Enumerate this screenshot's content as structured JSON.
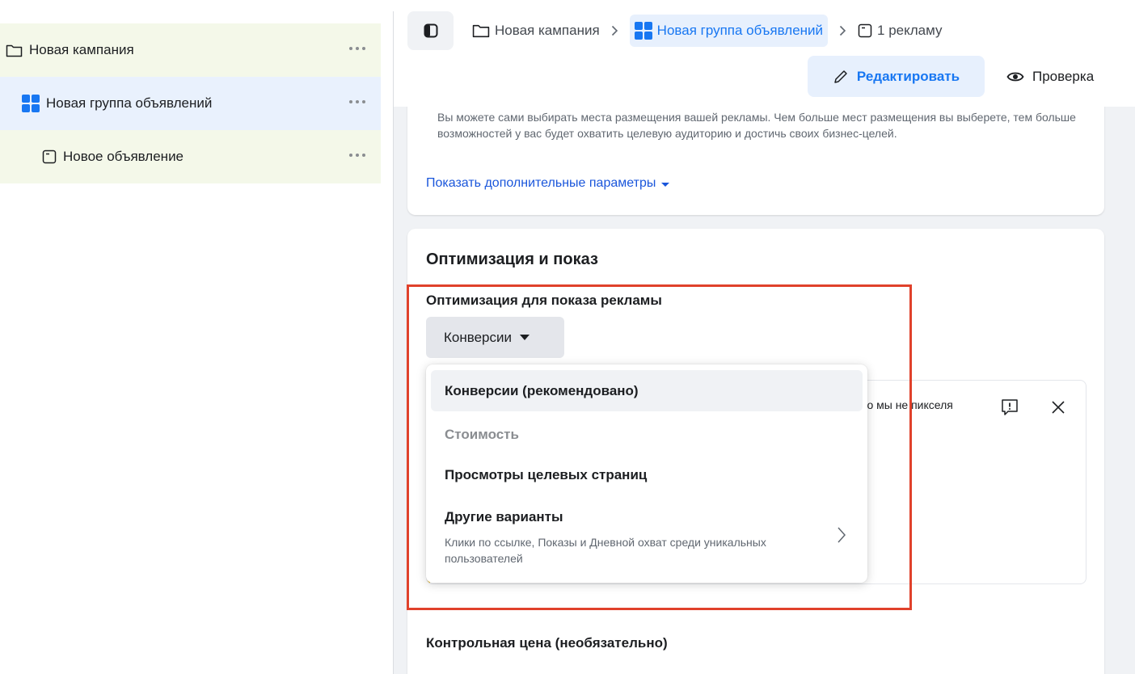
{
  "tree": {
    "campaign": "Новая кампания",
    "adset": "Новая группа объявлений",
    "ad": "Новое объявление"
  },
  "breadcrumb": {
    "campaign": "Новая кампания",
    "adset": "Новая группа объявлений",
    "ad": "1 рекламу"
  },
  "toolbar": {
    "edit": "Редактировать",
    "review": "Проверка"
  },
  "placements": {
    "description": "Вы можете сами выбирать места размещения вашей рекламы. Чем больше мест размещения вы выберете, тем больше возможностей у вас будет охватить целевую аудиторию и достичь своих бизнес-целей.",
    "show_more": "Показать дополнительные параметры"
  },
  "optimization": {
    "title": "Оптимизация и показ",
    "label": "Оптимизация для показа рекламы",
    "selected": "Конверсии",
    "notice_text": "у что мы не пикселя",
    "bid_label": "Контрольная цена (необязательно)"
  },
  "dropdown": {
    "items": [
      {
        "label": "Конверсии (рекомендовано)",
        "state": "selected"
      },
      {
        "label": "Стоимость",
        "state": "disabled"
      },
      {
        "label": "Просмотры целевых страниц",
        "state": "normal"
      },
      {
        "label": "Другие варианты",
        "sub": "Клики по ссылке, Показы и Дневной охват среди уникальных пользователей",
        "state": "submenu"
      }
    ]
  },
  "colors": {
    "accent": "#1877f2",
    "highlight": "#e0412b",
    "tree_green": "#f4f8e9",
    "tree_blue": "#e9f1fd"
  }
}
